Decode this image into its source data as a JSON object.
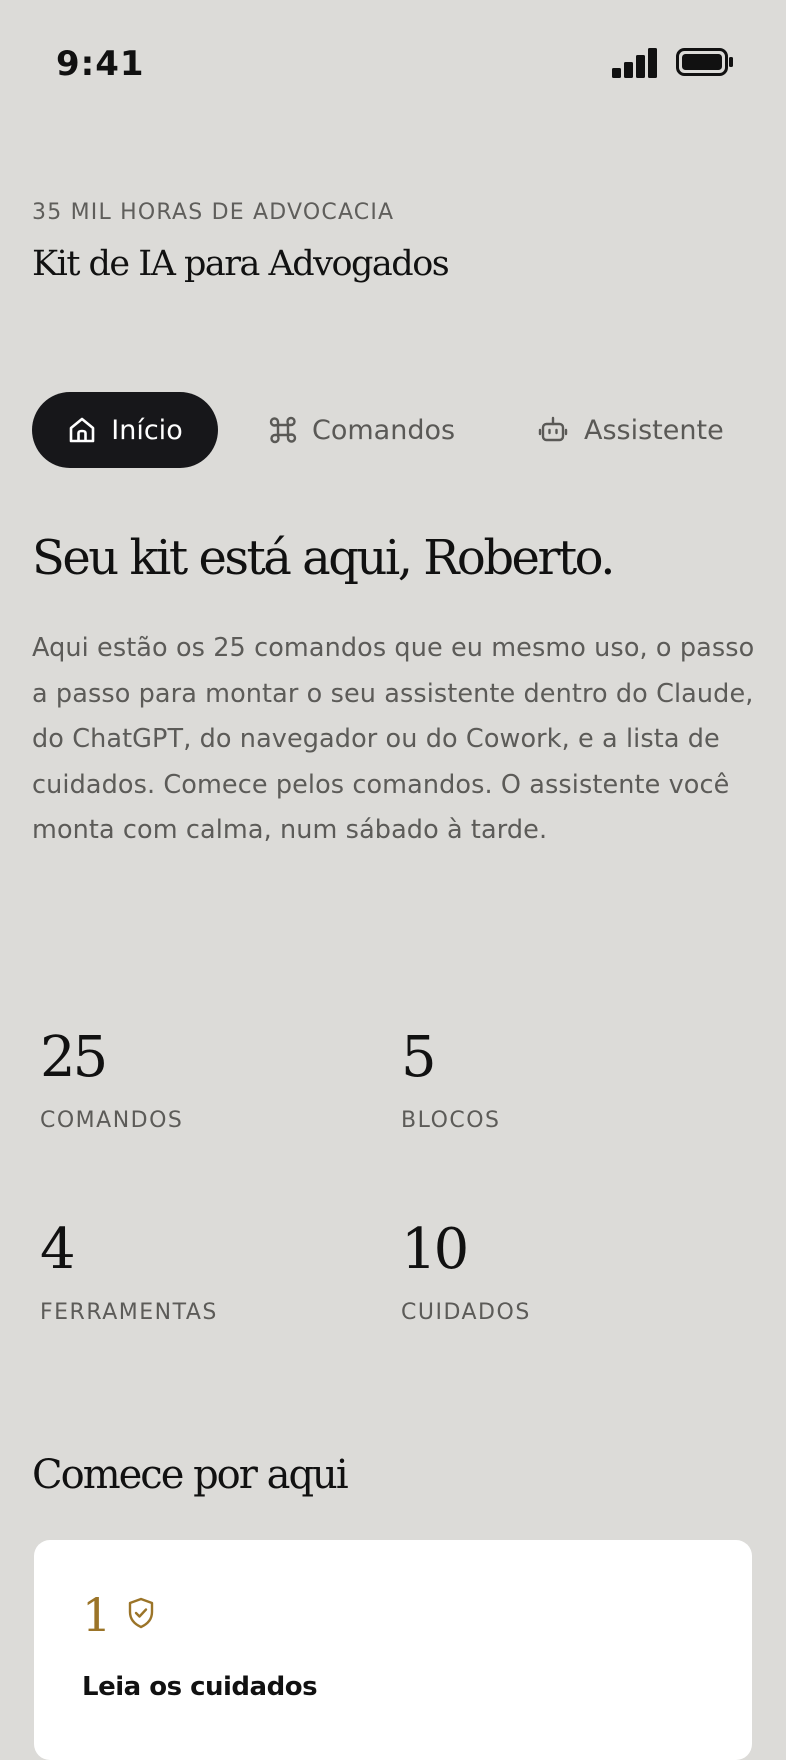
{
  "status_bar": {
    "time": "9:41",
    "signal_icon": "cellular-signal-icon",
    "battery_icon": "battery-icon"
  },
  "header": {
    "eyebrow": "35 MIL HORAS DE ADVOCACIA",
    "title": "Kit de IA para Advogados"
  },
  "tabs": [
    {
      "label": "Início",
      "icon": "home-icon",
      "active": true
    },
    {
      "label": "Comandos",
      "icon": "command-icon",
      "active": false
    },
    {
      "label": "Assistente",
      "icon": "robot-icon",
      "active": false
    }
  ],
  "hero": {
    "title": "Seu kit está aqui, Roberto.",
    "body": "Aqui estão os 25 comandos que eu mesmo uso, o passo a passo para montar o seu assistente dentro do Claude, do ChatGPT, do navegador ou do Cowork, e a lista de cuidados. Comece pelos comandos. O assistente você monta com calma, num sábado à tarde."
  },
  "stats": [
    {
      "value": "25",
      "label": "COMANDOS"
    },
    {
      "value": "5",
      "label": "BLOCOS"
    },
    {
      "value": "4",
      "label": "FERRAMENTAS"
    },
    {
      "value": "10",
      "label": "CUIDADOS"
    }
  ],
  "start_section": {
    "title": "Comece por aqui",
    "cards": [
      {
        "step": "1",
        "icon": "shield-check-icon",
        "title": "Leia os cuidados"
      }
    ]
  },
  "colors": {
    "background": "#dcdbd8",
    "active_tab": "#17171a",
    "accent_gold": "#9b7428",
    "muted_text": "#5c5b58"
  }
}
